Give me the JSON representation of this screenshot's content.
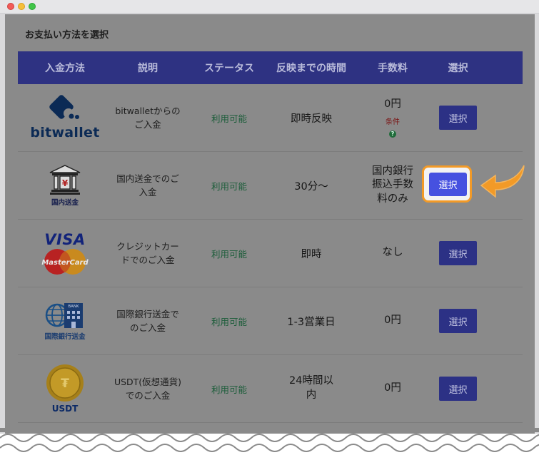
{
  "page": {
    "title": "お支払い方法を選択"
  },
  "table": {
    "headers": [
      "入金方法",
      "説明",
      "ステータス",
      "反映までの時間",
      "手数料",
      "選択"
    ],
    "rows": [
      {
        "logo_name": "bitwallet",
        "logo_text": "bitwallet",
        "desc_lines": [
          "bitwalletからの",
          "ご入金"
        ],
        "status": "利用可能",
        "time_lines": [
          "即時反映"
        ],
        "fee_lines": [
          "0円"
        ],
        "fee_note": "条件",
        "fee_icon": "?",
        "button": "選択"
      },
      {
        "logo_name": "domestic-bank",
        "logo_text": "国内送金",
        "desc_lines": [
          "国内送金でのご",
          "入金"
        ],
        "status": "利用可能",
        "time_lines": [
          "30分〜"
        ],
        "fee_lines": [
          "国内銀行",
          "振込手数",
          "料のみ"
        ],
        "button": "選択"
      },
      {
        "logo_name": "visa-mastercard",
        "logo_text": "VISA",
        "logo_text2": "MasterCard",
        "desc_lines": [
          "クレジットカー",
          "ドでのご入金"
        ],
        "status": "利用可能",
        "time_lines": [
          "即時"
        ],
        "fee_lines": [
          "なし"
        ],
        "button": "選択"
      },
      {
        "logo_name": "international-bank",
        "logo_text": "国際銀行送金",
        "logo_sign": "BANK",
        "desc_lines": [
          "国際銀行送金で",
          "のご入金"
        ],
        "status": "利用可能",
        "time_lines": [
          "1-3営業日"
        ],
        "fee_lines": [
          "0円"
        ],
        "button": "選択"
      },
      {
        "logo_name": "usdt",
        "logo_text": "USDT",
        "desc_lines": [
          "USDT(仮想通貨)",
          "でのご入金"
        ],
        "status": "利用可能",
        "time_lines": [
          "24時間以",
          "内"
        ],
        "fee_lines": [
          "0円"
        ],
        "button": "選択"
      }
    ]
  },
  "highlight": {
    "button": "選択"
  },
  "colors": {
    "header": "#3b3fa6",
    "highlight_border": "#f29a27",
    "active_button": "#4651e0",
    "arrow": "#f29a27"
  }
}
